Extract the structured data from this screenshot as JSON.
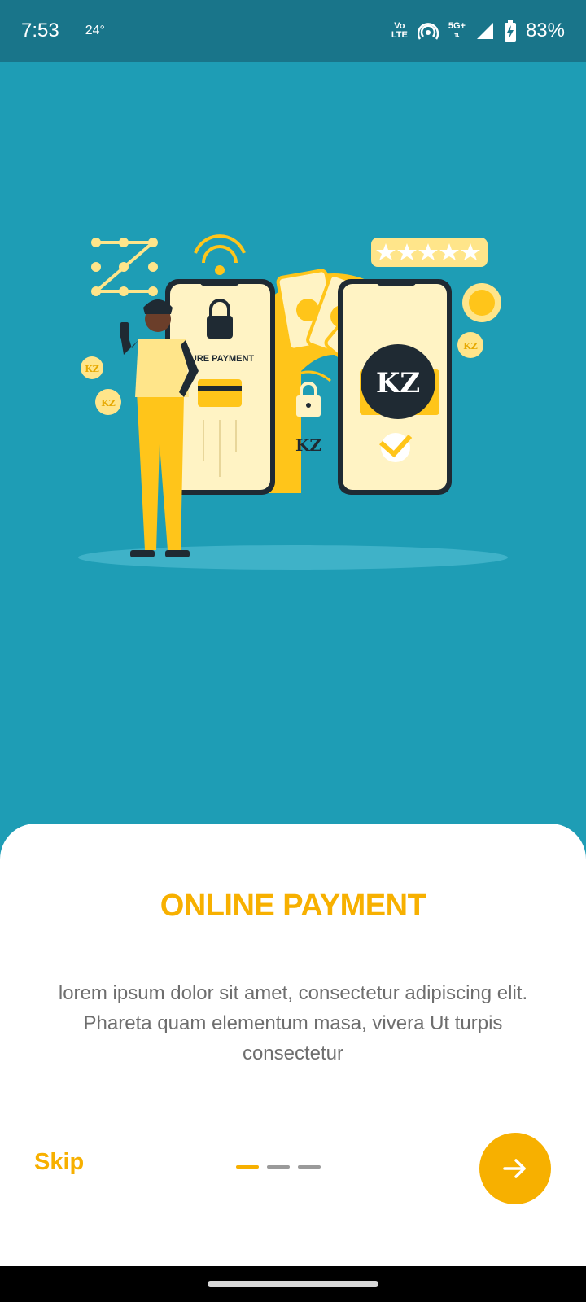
{
  "status_bar": {
    "time": "7:53",
    "temperature": "24°",
    "volte_line1": "Vo",
    "volte_line2": "LTE",
    "network": "5G+",
    "battery": "83%"
  },
  "illustration": {
    "secure_payment_label": "URE PAYMENT",
    "coin_label": "KZ",
    "badge_label": "KZ",
    "lock_caption": "KZ"
  },
  "onboarding": {
    "title": "ONLINE PAYMENT",
    "description": "lorem ipsum dolor sit amet, consectetur adipiscing elit. Phareta quam elementum masa, vivera Ut turpis consectetur",
    "skip_label": "Skip",
    "page_count": 3,
    "current_page": 1
  },
  "colors": {
    "accent": "#f7b000",
    "hero_background": "#1e9db5",
    "status_bar": "#19758a",
    "text_muted": "#6e6e6e"
  },
  "icons": {
    "next": "arrow-right-icon",
    "wifi": "hotspot-icon",
    "signal": "signal-icon",
    "battery": "battery-charging-icon"
  }
}
